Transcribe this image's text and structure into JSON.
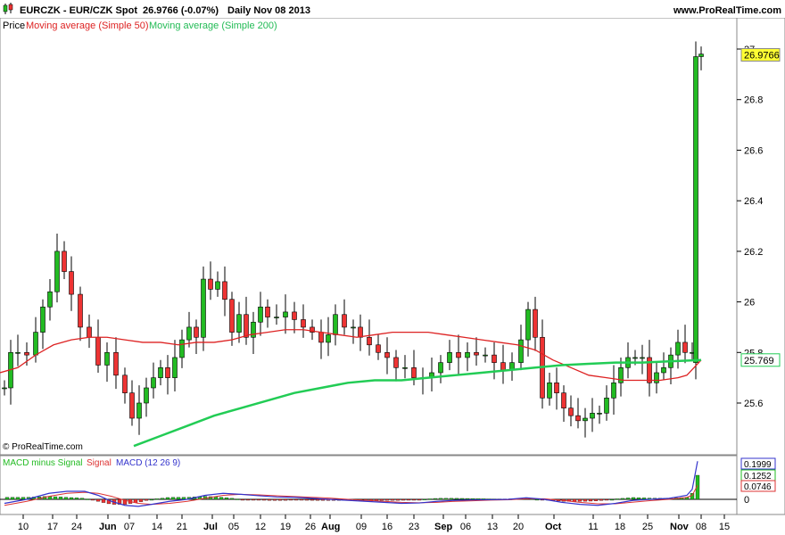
{
  "header": {
    "symbol": "EURCZK - EUR/CZK Spot",
    "quote": "26.9766 (-0.07%)",
    "period": "Daily  Nov 08 2013",
    "site": "www.ProRealTime.com"
  },
  "legend": {
    "price_label": "Price",
    "ma50_label": "Moving average (Simple 50)",
    "ma200_label": "Moving average (Simple 200)"
  },
  "watermark": "© ProRealTime.com",
  "macd_legend": {
    "hist_label": "MACD minus Signal",
    "signal_label": "Signal",
    "macd_label": "MACD (12 26 9)"
  },
  "colors": {
    "up": "#22bb22",
    "down": "#ee3333",
    "ma50": "#dd2222",
    "ma200": "#22cc55",
    "macd": "#3333cc",
    "signal": "#dd3333",
    "tag_last": "#ffff33"
  },
  "chart_data": [
    {
      "type": "candlestick",
      "title": "EURCZK - EUR/CZK Spot",
      "y_ticks": [
        "25.6",
        "25.8",
        "26",
        "26.2",
        "26.4",
        "26.6",
        "26.8",
        "27"
      ],
      "ylim": [
        25.42,
        27.05
      ],
      "x_ticks": [
        "10",
        "17",
        "24",
        "Jun",
        "07",
        "14",
        "21",
        "Jul",
        "05",
        "12",
        "19",
        "26",
        "Aug",
        "09",
        "16",
        "23",
        "Sep",
        "06",
        "13",
        "20",
        "Oct",
        "11",
        "18",
        "25",
        "Nov",
        "08",
        "15"
      ],
      "last_value": "26.9766",
      "ma200_value": "25.769",
      "ma50": [
        [
          0,
          25.72
        ],
        [
          20,
          25.74
        ],
        [
          40,
          25.79
        ],
        [
          60,
          25.83
        ],
        [
          80,
          25.85
        ],
        [
          100,
          25.86
        ],
        [
          120,
          25.86
        ],
        [
          140,
          25.85
        ],
        [
          160,
          25.84
        ],
        [
          180,
          25.84
        ],
        [
          200,
          25.83
        ],
        [
          220,
          25.84
        ],
        [
          240,
          25.84
        ],
        [
          260,
          25.85
        ],
        [
          280,
          25.87
        ],
        [
          300,
          25.88
        ],
        [
          320,
          25.89
        ],
        [
          340,
          25.89
        ],
        [
          360,
          25.88
        ],
        [
          380,
          25.87
        ],
        [
          400,
          25.86
        ],
        [
          420,
          25.87
        ],
        [
          440,
          25.88
        ],
        [
          460,
          25.88
        ],
        [
          480,
          25.88
        ],
        [
          500,
          25.87
        ],
        [
          520,
          25.86
        ],
        [
          540,
          25.85
        ],
        [
          560,
          25.84
        ],
        [
          580,
          25.83
        ],
        [
          600,
          25.81
        ],
        [
          620,
          25.77
        ],
        [
          640,
          25.74
        ],
        [
          660,
          25.71
        ],
        [
          680,
          25.7
        ],
        [
          700,
          25.69
        ],
        [
          720,
          25.69
        ],
        [
          740,
          25.69
        ],
        [
          760,
          25.7
        ],
        [
          770,
          25.71
        ],
        [
          786,
          25.77
        ]
      ],
      "ma200": [
        [
          150,
          25.43
        ],
        [
          180,
          25.47
        ],
        [
          210,
          25.51
        ],
        [
          240,
          25.55
        ],
        [
          270,
          25.58
        ],
        [
          300,
          25.61
        ],
        [
          330,
          25.64
        ],
        [
          360,
          25.66
        ],
        [
          390,
          25.68
        ],
        [
          420,
          25.69
        ],
        [
          450,
          25.69
        ],
        [
          480,
          25.7
        ],
        [
          510,
          25.71
        ],
        [
          540,
          25.72
        ],
        [
          570,
          25.73
        ],
        [
          600,
          25.74
        ],
        [
          630,
          25.75
        ],
        [
          660,
          25.755
        ],
        [
          690,
          25.76
        ],
        [
          720,
          25.76
        ],
        [
          750,
          25.765
        ],
        [
          786,
          25.77
        ]
      ],
      "candles_anchor": [
        [
          5,
          25.66
        ],
        [
          12,
          25.8
        ],
        [
          20,
          25.8
        ],
        [
          30,
          25.79
        ],
        [
          40,
          25.88
        ],
        [
          48,
          25.98
        ],
        [
          56,
          26.04
        ],
        [
          64,
          26.2
        ],
        [
          72,
          26.12
        ],
        [
          80,
          26.03
        ],
        [
          90,
          25.9
        ],
        [
          100,
          25.86
        ],
        [
          110,
          25.75
        ],
        [
          120,
          25.8
        ],
        [
          130,
          25.71
        ],
        [
          140,
          25.64
        ],
        [
          148,
          25.54
        ],
        [
          156,
          25.6
        ],
        [
          164,
          25.66
        ],
        [
          172,
          25.7
        ],
        [
          180,
          25.74
        ],
        [
          188,
          25.7
        ],
        [
          196,
          25.78
        ],
        [
          204,
          25.85
        ],
        [
          212,
          25.9
        ],
        [
          220,
          25.86
        ],
        [
          228,
          26.09
        ],
        [
          236,
          26.05
        ],
        [
          244,
          26.08
        ],
        [
          252,
          26.01
        ],
        [
          260,
          25.88
        ],
        [
          268,
          25.95
        ],
        [
          276,
          25.86
        ],
        [
          284,
          25.92
        ],
        [
          292,
          25.98
        ],
        [
          300,
          25.94
        ],
        [
          310,
          25.94
        ],
        [
          320,
          25.96
        ],
        [
          330,
          25.93
        ],
        [
          340,
          25.9
        ],
        [
          350,
          25.88
        ],
        [
          360,
          25.84
        ],
        [
          368,
          25.87
        ],
        [
          376,
          25.95
        ],
        [
          386,
          25.9
        ],
        [
          396,
          25.9
        ],
        [
          404,
          25.86
        ],
        [
          414,
          25.83
        ],
        [
          424,
          25.8
        ],
        [
          434,
          25.78
        ],
        [
          444,
          25.74
        ],
        [
          454,
          25.74
        ],
        [
          464,
          25.7
        ],
        [
          474,
          25.7
        ],
        [
          484,
          25.72
        ],
        [
          494,
          25.76
        ],
        [
          504,
          25.8
        ],
        [
          514,
          25.78
        ],
        [
          524,
          25.8
        ],
        [
          534,
          25.79
        ],
        [
          544,
          25.79
        ],
        [
          554,
          25.76
        ],
        [
          564,
          25.73
        ],
        [
          574,
          25.76
        ],
        [
          584,
          25.85
        ],
        [
          592,
          25.97
        ],
        [
          600,
          25.86
        ],
        [
          608,
          25.62
        ],
        [
          616,
          25.68
        ],
        [
          624,
          25.64
        ],
        [
          632,
          25.58
        ],
        [
          640,
          25.55
        ],
        [
          648,
          25.53
        ],
        [
          656,
          25.54
        ],
        [
          664,
          25.56
        ],
        [
          672,
          25.56
        ],
        [
          680,
          25.62
        ],
        [
          688,
          25.68
        ],
        [
          696,
          25.74
        ],
        [
          704,
          25.78
        ],
        [
          712,
          25.78
        ],
        [
          720,
          25.78
        ],
        [
          728,
          25.68
        ],
        [
          736,
          25.72
        ],
        [
          744,
          25.74
        ],
        [
          752,
          25.79
        ],
        [
          760,
          25.84
        ],
        [
          768,
          25.8
        ],
        [
          776,
          25.8
        ],
        [
          780,
          26.97
        ],
        [
          786,
          26.98
        ]
      ]
    },
    {
      "type": "macd",
      "title": "MACD (12 26 9)",
      "params": "(12 26 9)",
      "y_ticks": [
        "0"
      ],
      "ylim": [
        -0.07,
        0.21
      ],
      "last_macd": "0.1999",
      "last_signal": "0.0746",
      "last_hist": "0.1252",
      "macd": [
        [
          5,
          -0.02
        ],
        [
          30,
          0.0
        ],
        [
          55,
          0.03
        ],
        [
          75,
          0.04
        ],
        [
          95,
          0.04
        ],
        [
          110,
          0.02
        ],
        [
          125,
          -0.01
        ],
        [
          140,
          -0.03
        ],
        [
          155,
          -0.035
        ],
        [
          170,
          -0.025
        ],
        [
          190,
          -0.01
        ],
        [
          210,
          0.0
        ],
        [
          230,
          0.02
        ],
        [
          250,
          0.03
        ],
        [
          270,
          0.025
        ],
        [
          290,
          0.018
        ],
        [
          310,
          0.012
        ],
        [
          330,
          0.01
        ],
        [
          350,
          0.005
        ],
        [
          370,
          0.0
        ],
        [
          390,
          -0.005
        ],
        [
          410,
          -0.01
        ],
        [
          430,
          -0.015
        ],
        [
          450,
          -0.02
        ],
        [
          470,
          -0.018
        ],
        [
          490,
          -0.01
        ],
        [
          510,
          -0.005
        ],
        [
          530,
          -0.003
        ],
        [
          550,
          -0.002
        ],
        [
          570,
          0.0
        ],
        [
          590,
          0.008
        ],
        [
          610,
          0.0
        ],
        [
          630,
          -0.015
        ],
        [
          650,
          -0.025
        ],
        [
          670,
          -0.03
        ],
        [
          690,
          -0.02
        ],
        [
          710,
          -0.005
        ],
        [
          730,
          0.0
        ],
        [
          750,
          0.005
        ],
        [
          770,
          0.02
        ],
        [
          776,
          0.05
        ],
        [
          782,
          0.19
        ]
      ],
      "signal": [
        [
          5,
          -0.03
        ],
        [
          30,
          -0.01
        ],
        [
          55,
          0.015
        ],
        [
          75,
          0.03
        ],
        [
          95,
          0.035
        ],
        [
          110,
          0.03
        ],
        [
          125,
          0.015
        ],
        [
          140,
          -0.005
        ],
        [
          155,
          -0.02
        ],
        [
          170,
          -0.025
        ],
        [
          190,
          -0.02
        ],
        [
          210,
          -0.01
        ],
        [
          230,
          0.005
        ],
        [
          250,
          0.02
        ],
        [
          270,
          0.025
        ],
        [
          290,
          0.022
        ],
        [
          310,
          0.018
        ],
        [
          330,
          0.014
        ],
        [
          350,
          0.01
        ],
        [
          370,
          0.006
        ],
        [
          390,
          0.0
        ],
        [
          410,
          -0.005
        ],
        [
          430,
          -0.01
        ],
        [
          450,
          -0.015
        ],
        [
          470,
          -0.017
        ],
        [
          490,
          -0.015
        ],
        [
          510,
          -0.01
        ],
        [
          530,
          -0.007
        ],
        [
          550,
          -0.004
        ],
        [
          570,
          -0.002
        ],
        [
          590,
          0.003
        ],
        [
          610,
          0.003
        ],
        [
          630,
          -0.005
        ],
        [
          650,
          -0.015
        ],
        [
          670,
          -0.022
        ],
        [
          690,
          -0.022
        ],
        [
          710,
          -0.014
        ],
        [
          730,
          -0.006
        ],
        [
          750,
          0.0
        ],
        [
          770,
          0.01
        ],
        [
          776,
          0.02
        ],
        [
          782,
          0.07
        ]
      ]
    }
  ]
}
